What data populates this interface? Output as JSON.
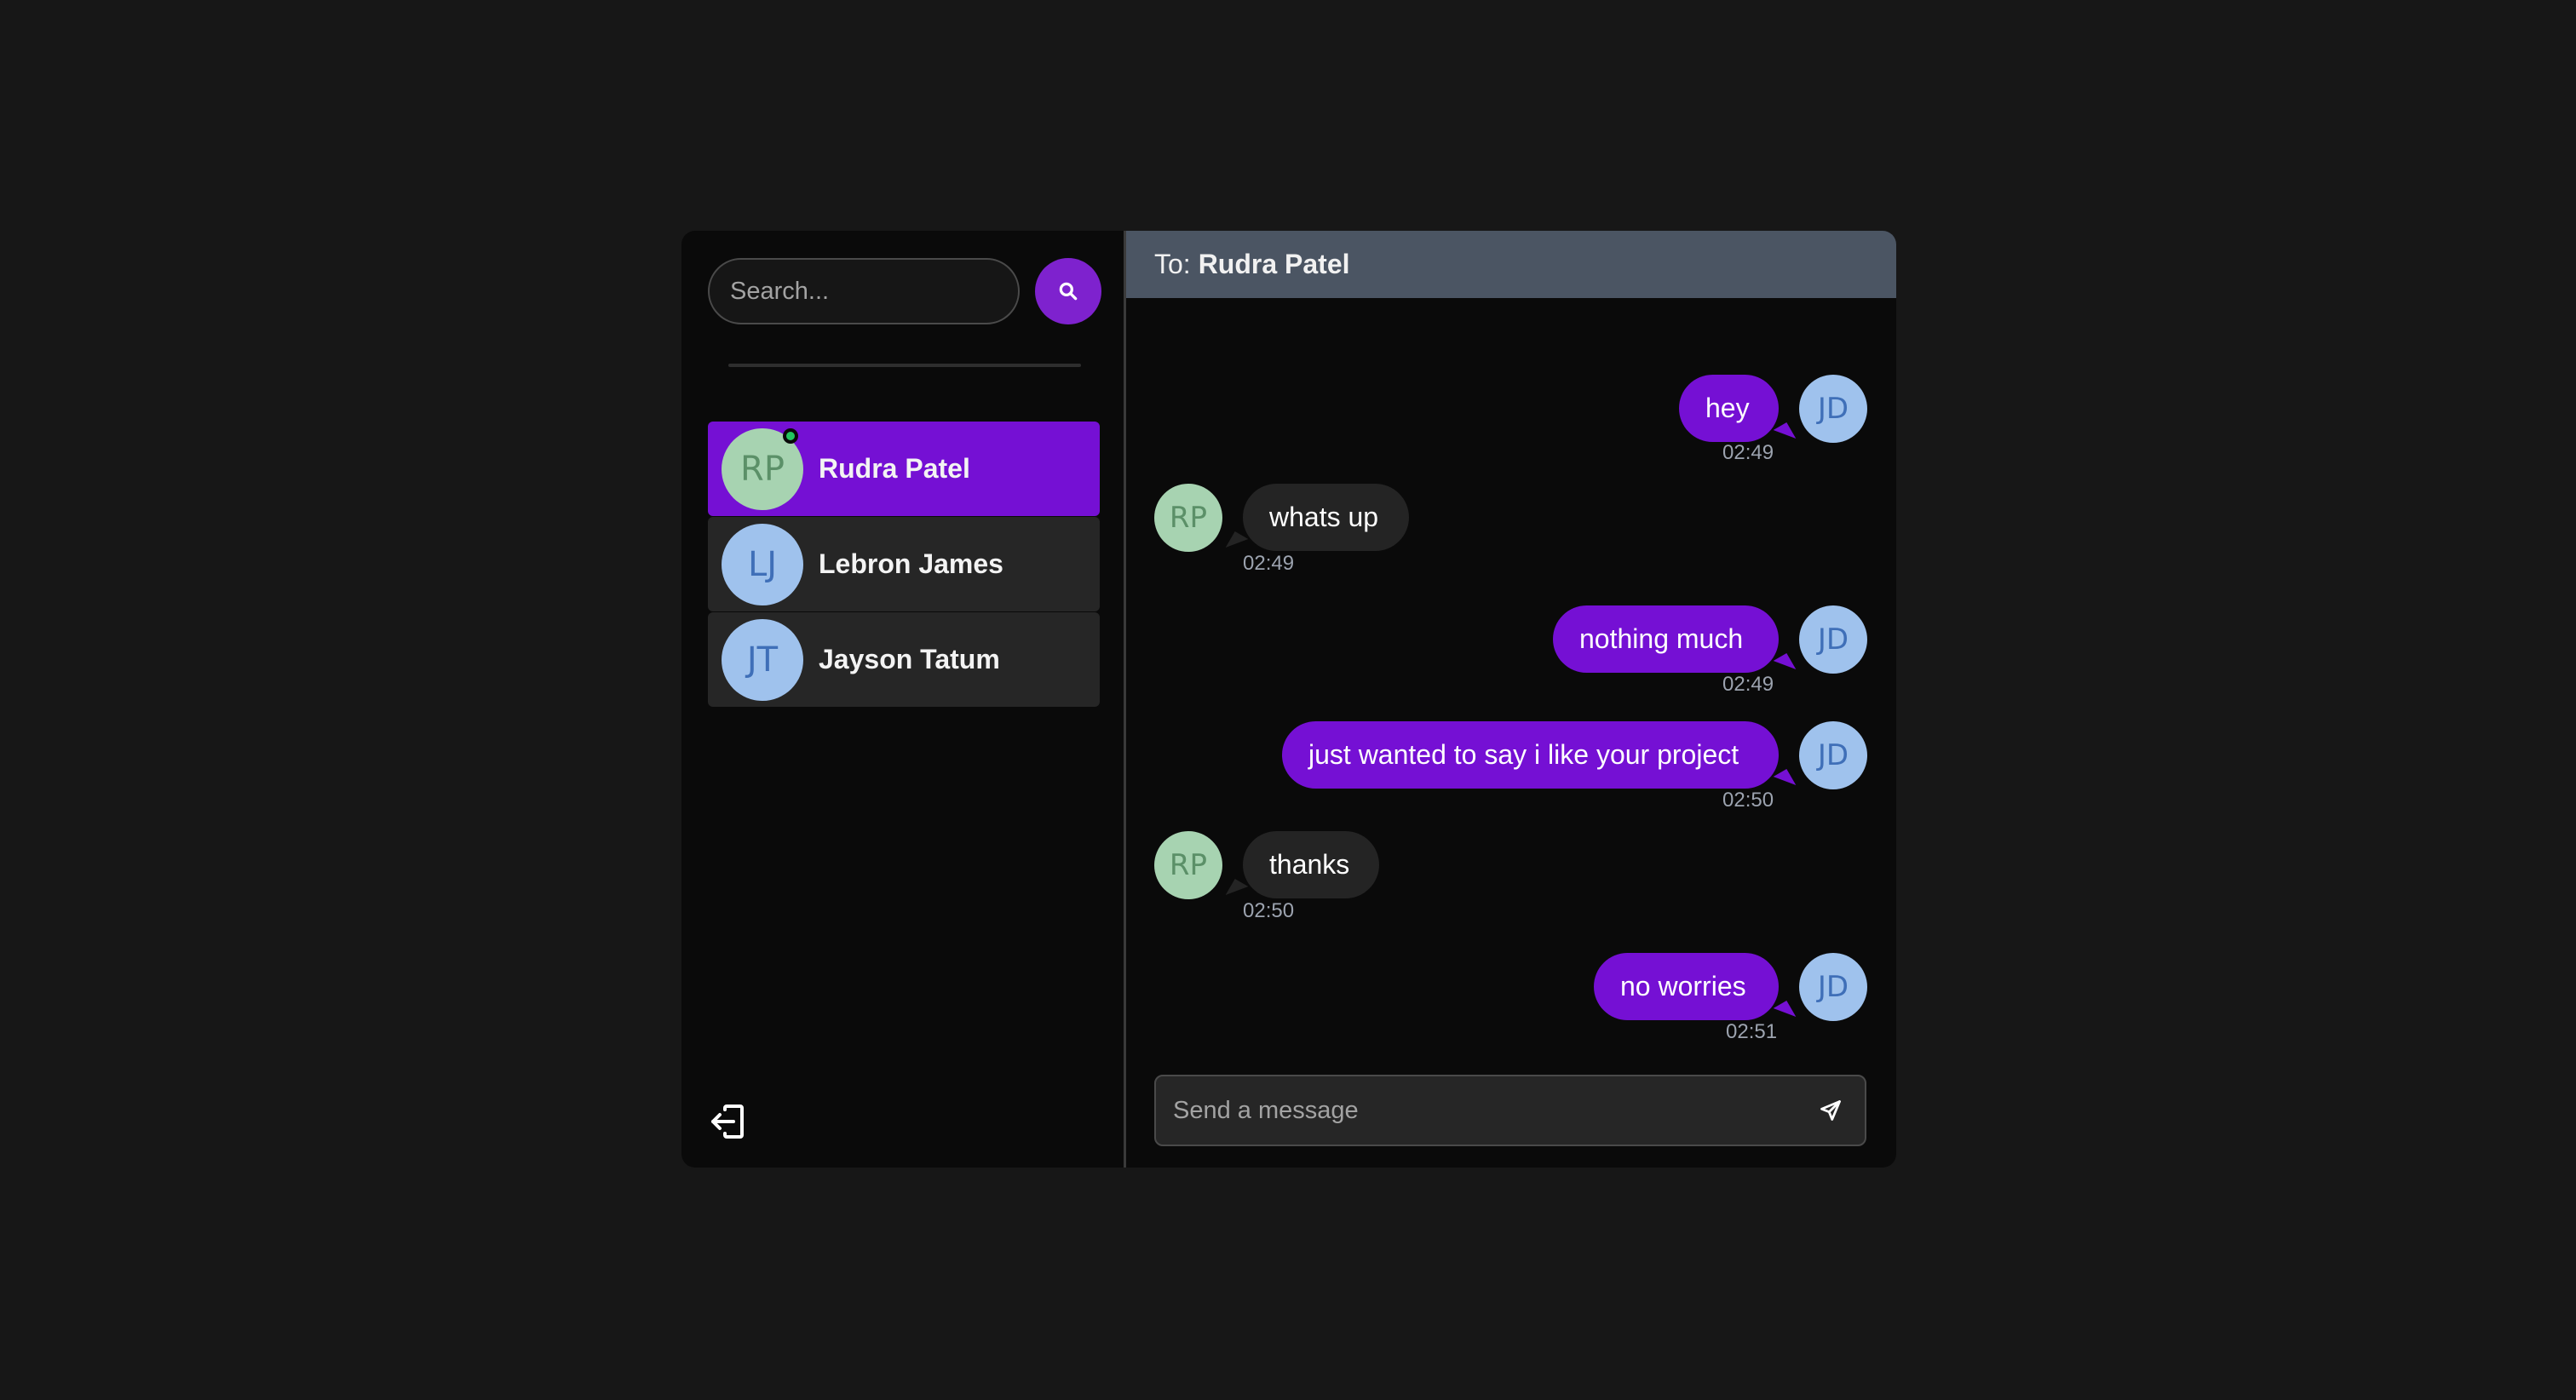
{
  "sidebar": {
    "search": {
      "placeholder": "Search...",
      "value": ""
    },
    "search_button_icon": "search-icon",
    "conversations": [
      {
        "initials": "RP",
        "name": "Rudra Patel",
        "active": true,
        "online": true,
        "avatar_color": "green"
      },
      {
        "initials": "LJ",
        "name": "Lebron James",
        "active": false,
        "online": false,
        "avatar_color": "blue"
      },
      {
        "initials": "JT",
        "name": "Jayson Tatum",
        "active": false,
        "online": false,
        "avatar_color": "blue"
      }
    ],
    "logout_icon": "logout-icon"
  },
  "chat": {
    "header": {
      "prefix": "To:",
      "name": "Rudra Patel"
    },
    "messages": [
      {
        "from": "me",
        "initials": "JD",
        "text": "hey",
        "time": "02:49"
      },
      {
        "from": "them",
        "initials": "RP",
        "text": "whats up",
        "time": "02:49"
      },
      {
        "from": "me",
        "initials": "JD",
        "text": "nothing much",
        "time": "02:49"
      },
      {
        "from": "me",
        "initials": "JD",
        "text": "just wanted to say i like your project",
        "time": "02:50"
      },
      {
        "from": "them",
        "initials": "RP",
        "text": "thanks",
        "time": "02:50"
      },
      {
        "from": "me",
        "initials": "JD",
        "text": "no worries",
        "time": "02:51"
      }
    ],
    "composer": {
      "placeholder": "Send a message",
      "value": ""
    },
    "send_icon": "send-icon"
  },
  "colors": {
    "accent": "#7510d4",
    "search_button": "#7e22ce",
    "incoming_bubble": "#242424",
    "header_bg": "#4b5563",
    "online_dot": "#22c55e"
  }
}
